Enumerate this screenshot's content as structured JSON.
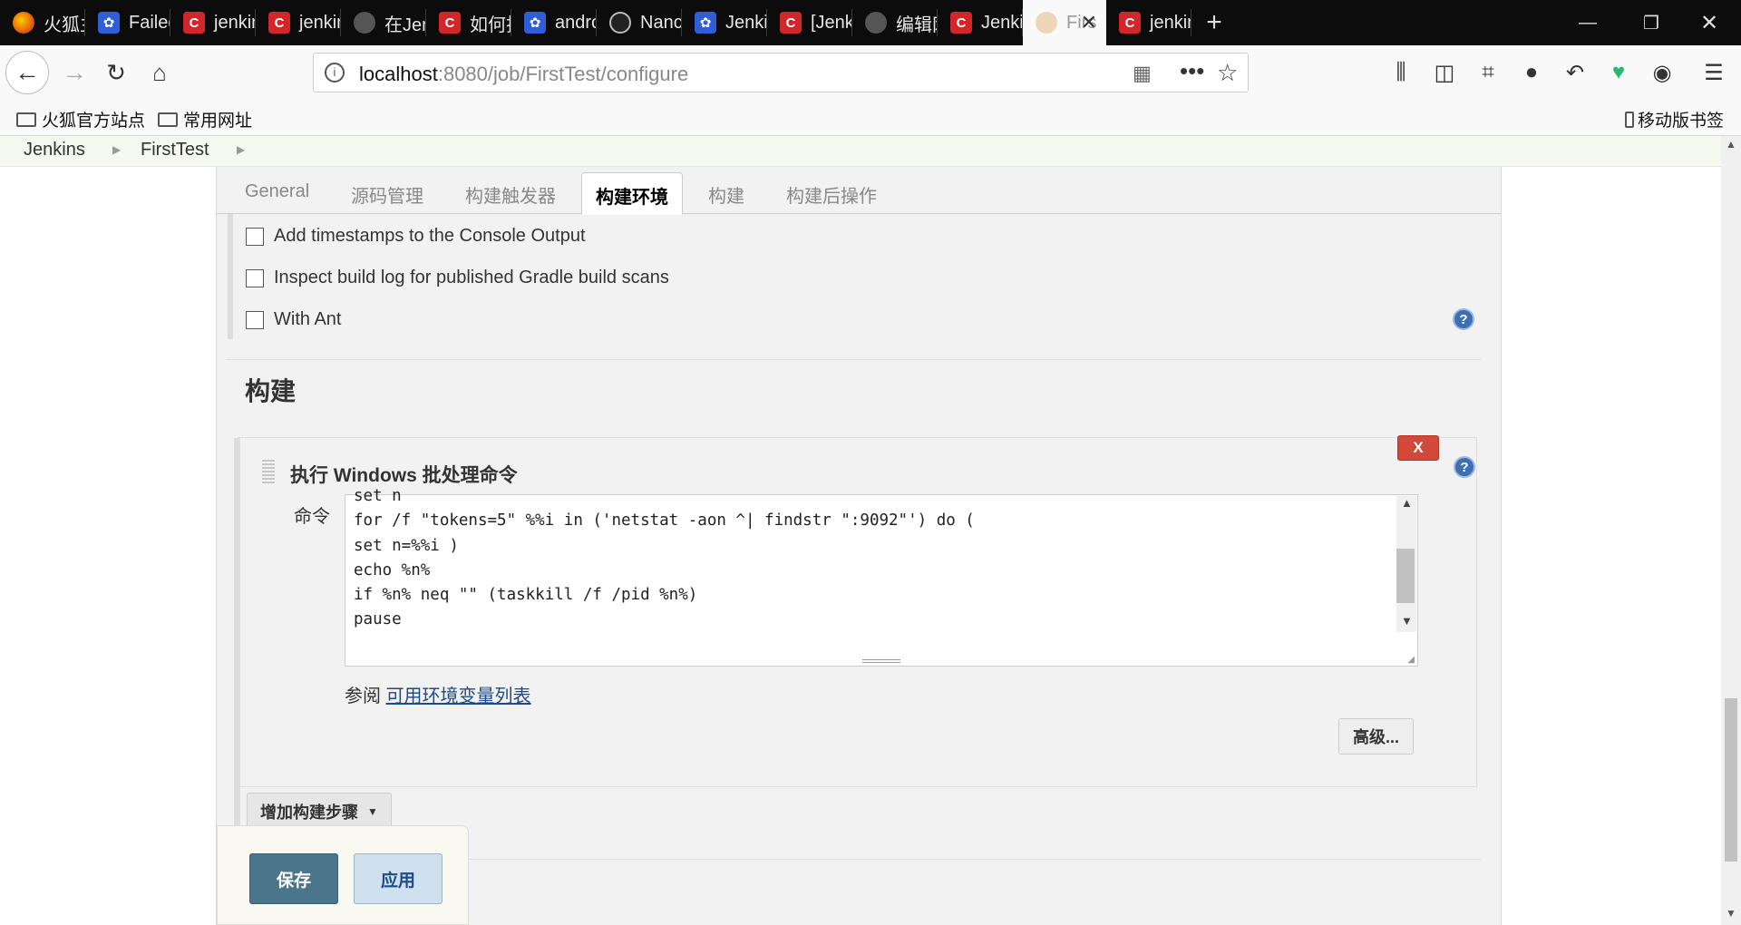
{
  "browser": {
    "tabs": [
      {
        "title": "火狐主页",
        "favicon": "firefox-icon"
      },
      {
        "title": "Failed",
        "favicon": "baidu-icon"
      },
      {
        "title": "jenkins",
        "favicon": "csdn-icon"
      },
      {
        "title": "jenkins",
        "favicon": "csdn-icon"
      },
      {
        "title": "在Jenk",
        "favicon": "generic-icon"
      },
      {
        "title": "如何找",
        "favicon": "csdn-icon"
      },
      {
        "title": "andro",
        "favicon": "baidu-icon"
      },
      {
        "title": "Nancy",
        "favicon": "github-icon"
      },
      {
        "title": "Jenkin",
        "favicon": "baidu-icon"
      },
      {
        "title": "[Jenki",
        "favicon": "csdn-icon"
      },
      {
        "title": "编辑网",
        "favicon": "generic-icon"
      },
      {
        "title": "Jenkin",
        "favicon": "csdn-icon"
      },
      {
        "title": "Firs",
        "favicon": "jenkins-icon",
        "active": true
      },
      {
        "title": "jenkin",
        "favicon": "csdn-icon"
      }
    ],
    "new_tab": "+",
    "url_host": "localhost",
    "url_rest": ":8080/job/FirstTest/configure",
    "bookmarks": [
      "火狐官方站点",
      "常用网址"
    ],
    "mobile_bookmarks": "移动版书签"
  },
  "breadcrumb": [
    "Jenkins",
    "FirstTest"
  ],
  "config_tabs": [
    "General",
    "源码管理",
    "构建触发器",
    "构建环境",
    "构建",
    "构建后操作"
  ],
  "active_tab": "构建环境",
  "build_env_options": [
    {
      "label": "Add timestamps to the Console Output",
      "checked": false
    },
    {
      "label": "Inspect build log for published Gradle build scans",
      "checked": false
    },
    {
      "label": "With Ant",
      "checked": false
    }
  ],
  "build_section_title": "构建",
  "build_step": {
    "title": "执行 Windows 批处理命令",
    "delete_label": "X",
    "command_label": "命令",
    "command_lines": [
      "set n",
      "for /f \"tokens=5\" %%i in ('netstat -aon ^| findstr \":9092\"') do (",
      "set n=%%i )",
      "echo %n%",
      "if %n% neq \"\" (taskkill /f /pid %n%)",
      "pause"
    ],
    "see_prefix": "参阅",
    "env_link": "可用环境变量列表",
    "advanced_label": "高级..."
  },
  "add_step_label": "增加构建步骤",
  "save_label": "保存",
  "apply_label": "应用",
  "help_glyph": "?",
  "colors": {
    "tabbar_bg": "#0c0c0d",
    "delete_red": "#d24939",
    "save_blue": "#4b758b",
    "link_blue": "#204a87",
    "breadcrumb_bg": "#f4f8ee"
  }
}
